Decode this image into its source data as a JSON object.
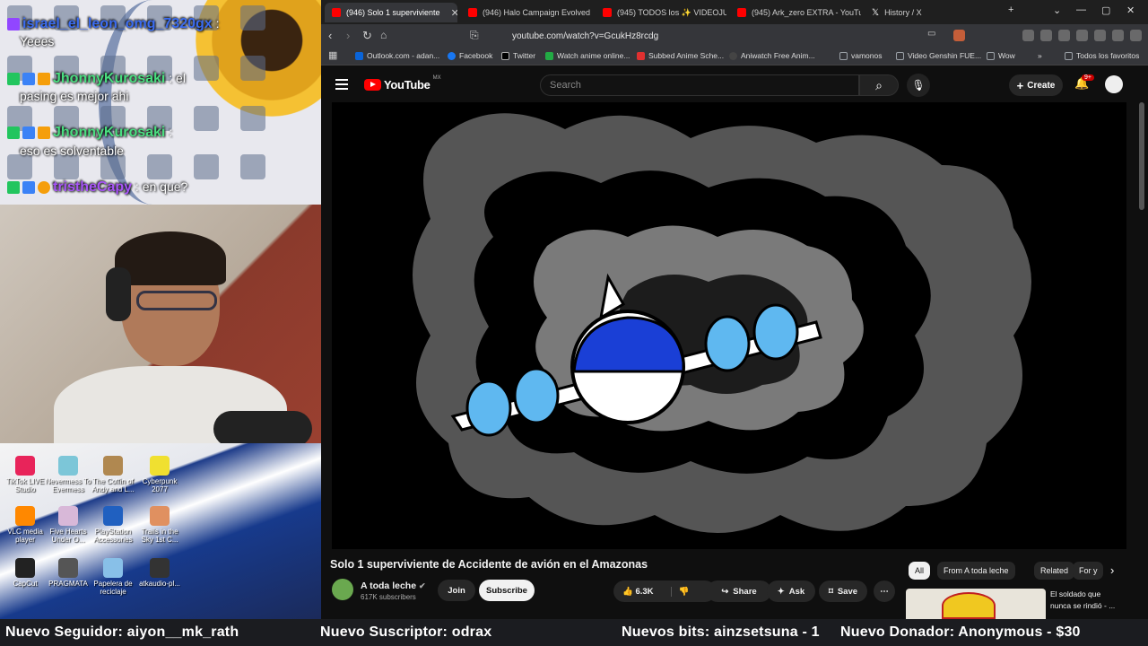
{
  "stream_overlay": {
    "chat": [
      {
        "user": "israel_el_leon_omg_7320gx",
        "message": "Yeees",
        "user_color": "#3b6cf0"
      },
      {
        "user": "JhonnyKurosaki",
        "message": "pasing es mejor ahi",
        "user_color": "#4ade80"
      },
      {
        "user": "JhonnyKurosaki",
        "message": "eso es solventable",
        "user_color": "#4ade80"
      },
      {
        "user": "tristheCapy",
        "message": "en que?",
        "user_color": "#a855f7"
      }
    ],
    "desktop_icons": [
      {
        "label": "TikTok LIVE Studio",
        "color": "#e8245a"
      },
      {
        "label": "Nevermess To Evermess",
        "color": "#7cc6d8"
      },
      {
        "label": "The Coffin of Andy and L...",
        "color": "#b08850"
      },
      {
        "label": "Cyberpunk 2077",
        "color": "#f0e030"
      },
      {
        "label": "VLC media player",
        "color": "#ff8800"
      },
      {
        "label": "Five Hearts Under O...",
        "color": "#d8b8d8"
      },
      {
        "label": "PlayStation Accessories",
        "color": "#2060c0"
      },
      {
        "label": "Trails in the Sky 1st C...",
        "color": "#e09060"
      },
      {
        "label": "CapCut",
        "color": "#222222"
      },
      {
        "label": "PRAGMATA",
        "color": "#555555"
      },
      {
        "label": "Papelera de reciclaje",
        "color": "#88c0e8"
      },
      {
        "label": "atkaudio-pl...",
        "color": "#333333"
      }
    ]
  },
  "browser": {
    "tabs": [
      {
        "title": "(946) Solo 1 superviviente",
        "active": true
      },
      {
        "title": "(946) Halo Campaign Evolved Es",
        "active": false
      },
      {
        "title": "(945) TODOS los ✨ VIDEOJUEGO",
        "active": false
      },
      {
        "title": "(945) Ark_zero EXTRA - YouTube",
        "active": false
      },
      {
        "title": "History / X",
        "active": false
      }
    ],
    "url": "youtube.com/watch?v=GcukHz8rcdg",
    "bookmarks": [
      {
        "label": "Outlook.com - adan...",
        "color": "#0a64d8"
      },
      {
        "label": "Facebook",
        "color": "#1877f2"
      },
      {
        "label": "Twitter",
        "color": "#000000"
      },
      {
        "label": "Watch anime online...",
        "color": "#22aa44"
      },
      {
        "label": "Subbed Anime Sche...",
        "color": "#e03030"
      },
      {
        "label": "Aniwatch Free Anim...",
        "color": "#444444"
      },
      {
        "label": "vamonos",
        "color": "#9aa0a6"
      },
      {
        "label": "Video Genshin FUE...",
        "color": "#9aa0a6"
      },
      {
        "label": "Wow",
        "color": "#9aa0a6"
      }
    ],
    "bookmarks_more": "»",
    "all_bookmarks": "Todos los favoritos"
  },
  "youtube": {
    "logo_text": "YouTube",
    "country_code": "MX",
    "search_placeholder": "Search",
    "create_label": "Create",
    "notification_count": "9+",
    "video_title": "Solo 1 superviviente de Accidente de avión en el Amazonas",
    "channel_name": "A toda leche",
    "channel_subscribers": "617K subscribers",
    "join_label": "Join",
    "subscribe_label": "Subscribe",
    "like_count": "6.3K",
    "share_label": "Share",
    "ask_label": "Ask",
    "save_label": "Save",
    "chips": [
      "All",
      "From A toda leche",
      "Related",
      "For y"
    ],
    "recommended_title": "El soldado que nunca se rindió - ..."
  },
  "ticker": {
    "follower": "Nuevo Seguidor: aiyon__mk_rath",
    "subscriber": "Nuevo Suscriptor: odrax",
    "bits": "Nuevos bits: ainzsetsuna - 1",
    "donor": "Nuevo Donador: Anonymous - $30"
  },
  "colors": {
    "youtube_red": "#ff0000",
    "plane_blue": "#1a3fd6",
    "window_blue": "#5fb8f0"
  }
}
